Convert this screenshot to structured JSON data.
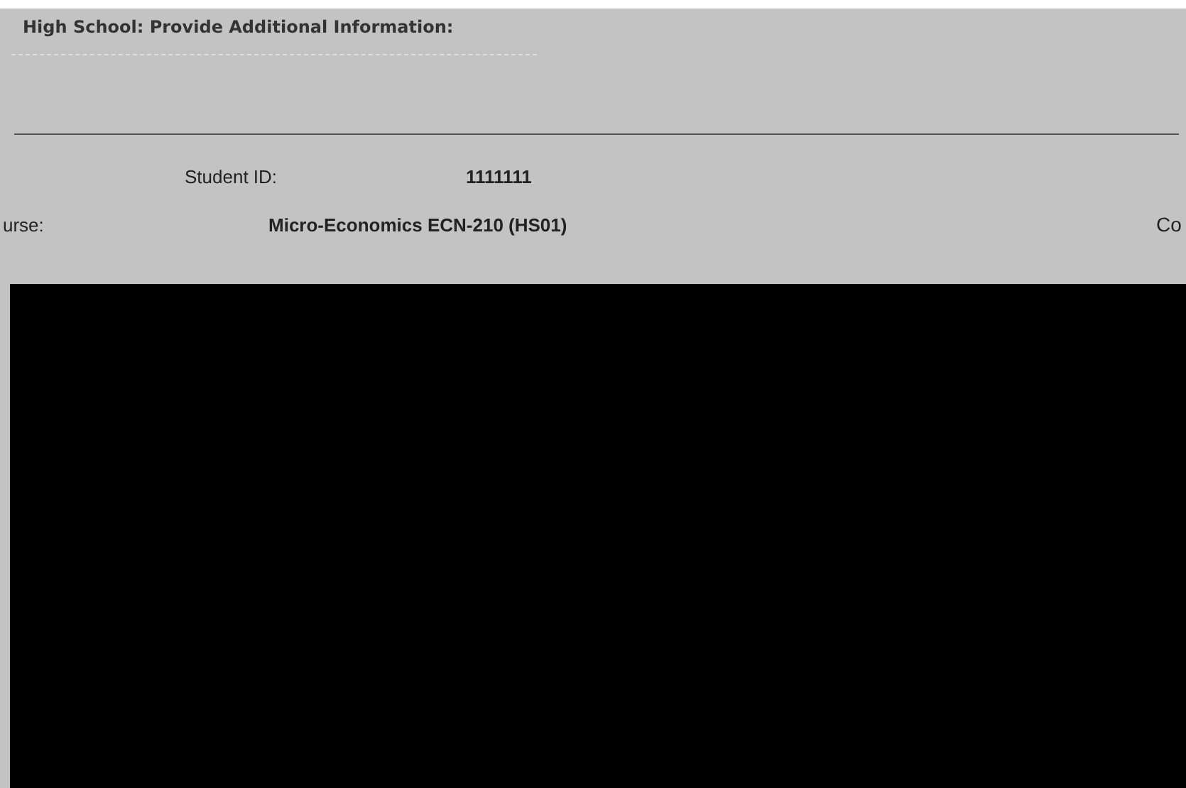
{
  "header": {
    "title": "High School: Provide Additional Information:"
  },
  "student": {
    "label": "Student ID:",
    "value": "1111111"
  },
  "course": {
    "label": "urse:",
    "value": "Micro-Economics ECN-210 (HS01)",
    "cut_label": "Co"
  }
}
